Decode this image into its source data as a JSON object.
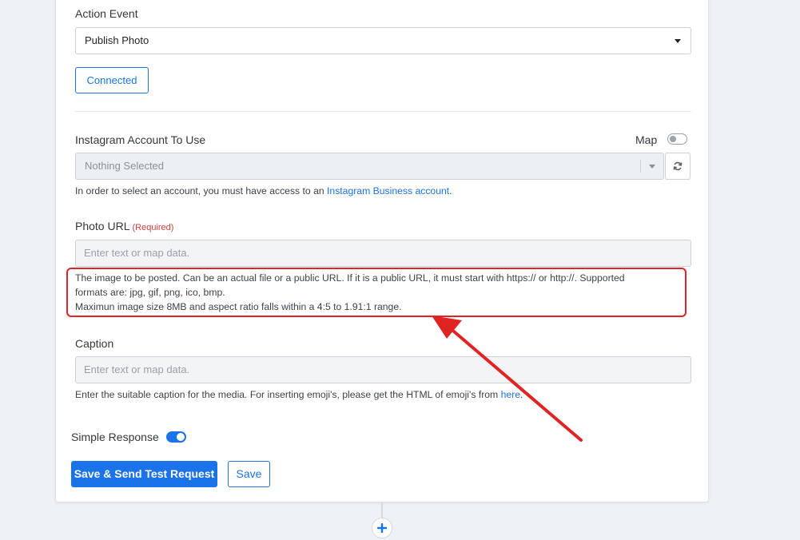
{
  "action_event": {
    "label": "Action Event",
    "selected": "Publish Photo"
  },
  "connection": {
    "button_label": "Connected"
  },
  "instagram_account": {
    "label": "Instagram Account To Use",
    "map_label": "Map",
    "map_toggle_on": false,
    "selected": "Nothing Selected",
    "help_prefix": "In order to select an account, you must have access to an ",
    "help_link": "Instagram Business account",
    "help_suffix": "."
  },
  "photo_url": {
    "label": "Photo URL",
    "required_label": "(Required)",
    "placeholder": "Enter text or map data.",
    "help_line1": "The image to be posted. Can be an actual file or a public URL. If it is a public URL, it must start with https:// or http://. Supported",
    "help_line2": "formats are: jpg, gif, png, ico, bmp.",
    "help_line3": "Maximun image size 8MB and aspect ratio falls within a 4:5 to 1.91:1 range."
  },
  "caption": {
    "label": "Caption",
    "placeholder": "Enter text or map data.",
    "help_prefix": "Enter the suitable caption for the media. For inserting emoji's, please get the HTML of emoji's from ",
    "help_link": "here",
    "help_suffix": "."
  },
  "simple_response": {
    "label": "Simple Response",
    "toggle_on": true
  },
  "actions": {
    "save_test_label": "Save & Send Test Request",
    "save_label": "Save"
  },
  "colors": {
    "accent": "#1a73e8",
    "required": "#d43f3a",
    "annotation": "#e02424"
  },
  "icons": {
    "refresh": "refresh-icon",
    "add_step": "plus-icon",
    "dropdown": "caret-down-icon"
  }
}
